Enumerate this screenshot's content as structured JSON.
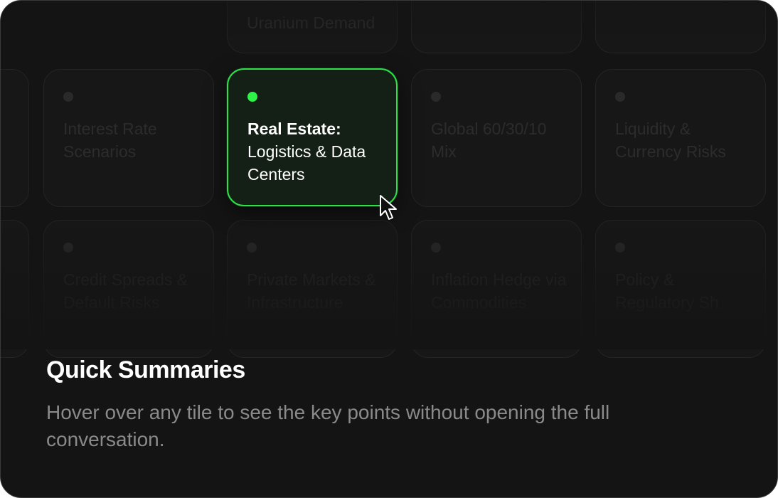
{
  "tiles": [
    {
      "label": "Uranium Demand"
    },
    {
      "label": ""
    },
    {
      "label": ""
    },
    {
      "label": ""
    },
    {
      "label": "Interest Rate Scenarios"
    },
    {
      "heading": "Real Estate:",
      "label": "Logistics & Data Centers"
    },
    {
      "label": "Global 60/30/10 Mix"
    },
    {
      "label": "Liquidity & Currency Risks"
    },
    {
      "label": ""
    },
    {
      "label": "Credit Spreads & Default Risks"
    },
    {
      "label": "Private Markets & Infrastructure"
    },
    {
      "label": "Inflation Hedge via Commodities"
    },
    {
      "label": "Policy & Regulatory Sh"
    }
  ],
  "feature": {
    "title": "Quick Summaries",
    "description": "Hover over any tile to see the key points without opening the full conversation."
  },
  "colors": {
    "accent": "#2fe04a",
    "card_bg": "#141414",
    "tile_bg": "#171717"
  },
  "icons": {
    "cursor": "mouse-pointer-icon",
    "dot": "status-dot-icon"
  }
}
